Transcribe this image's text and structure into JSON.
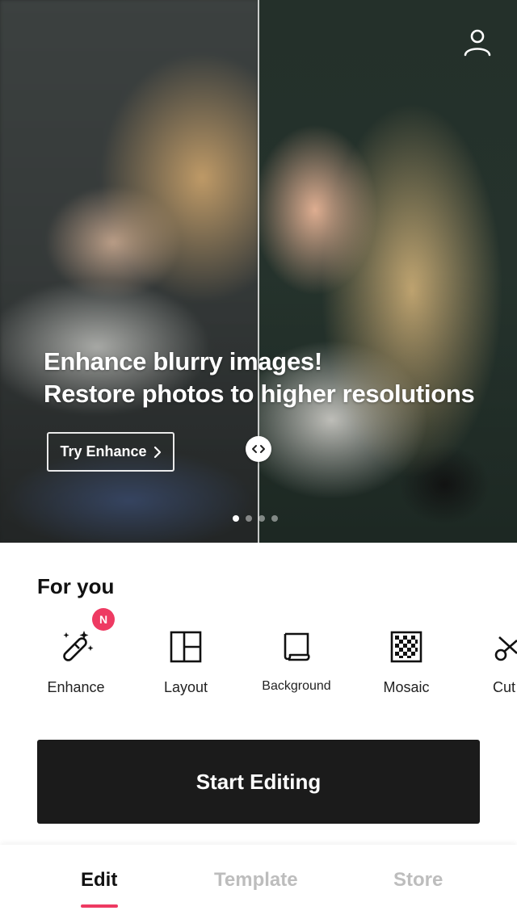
{
  "hero": {
    "title_line1": "Enhance blurry images!",
    "title_line2": "Restore photos to higher resolutions",
    "cta_label": "Try Enhance",
    "carousel_pages": 4,
    "carousel_active_index": 0
  },
  "for_you": {
    "title": "For you",
    "badge": "N",
    "tools": [
      {
        "label": "Enhance",
        "icon": "magic-wand-icon"
      },
      {
        "label": "Layout",
        "icon": "layout-icon"
      },
      {
        "label": "Background",
        "icon": "background-icon"
      },
      {
        "label": "Mosaic",
        "icon": "mosaic-icon"
      },
      {
        "label": "Cut",
        "icon": "scissors-icon"
      }
    ]
  },
  "start_button_label": "Start Editing",
  "tabs": [
    {
      "label": "Edit",
      "active": true
    },
    {
      "label": "Template",
      "active": false
    },
    {
      "label": "Store",
      "active": false
    }
  ],
  "colors": {
    "accent": "#ee3a62",
    "primary_button": "#1b1b1b",
    "inactive_tab": "#bdbdbd"
  }
}
